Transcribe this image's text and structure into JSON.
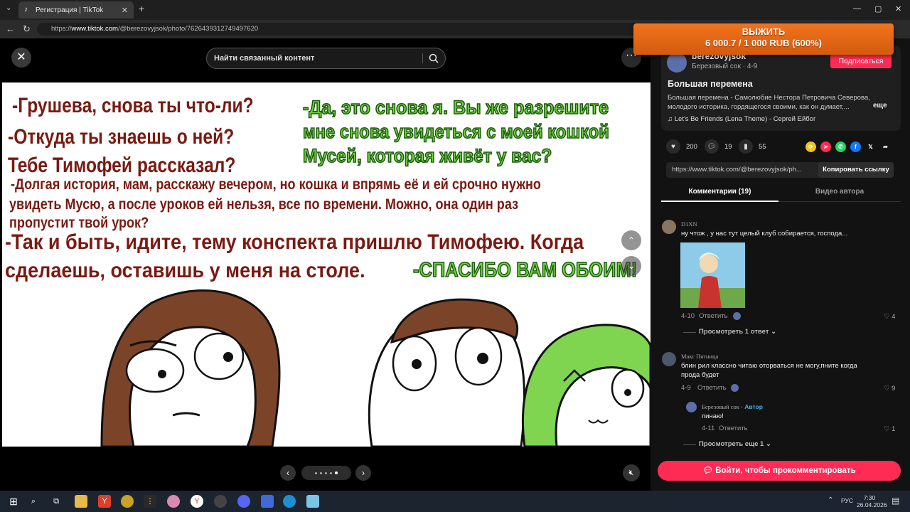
{
  "browser": {
    "tab_title": "Регистрация | TikTok",
    "url_prefix": "https://",
    "url_host": "www.tiktok.com",
    "url_path": "/@berezovyjsok/photo/7626439312749497620"
  },
  "viewer": {
    "search_placeholder": "Найти связанный контент",
    "comic_lines": [
      "-Грушева, снова ты что-ли?",
      "-Откуда ты знаешь о ней?",
      "Тебе Тимофей рассказал?",
      "-Долгая история, мам, расскажу вечером, но кошка и впрямь её и ей срочно нужно",
      "увидеть Мусю, а после уроков ей нельзя, все по времени. Можно, она один раз",
      "пропустит твой урок?",
      "-Так и быть, идите, тему конспекта пришлю Тимофею. Когда",
      "сделаешь, оставишь у меня на столе."
    ],
    "comic_green_lines": [
      "-Да, это снова я. Вы же разрешите",
      "мне снова увидеться с моей кошкой",
      "Мусей, которая живёт у вас?",
      "-СПАСИБО ВАМ ОБОИМ!"
    ],
    "slide_count": 5,
    "active_slide": 5
  },
  "overlay": {
    "title": "ВЫЖИТЬ",
    "amount": "6 000.7 / 1 000 RUB (600%)"
  },
  "author": {
    "name": "berezovyjsok",
    "subtitle": "Березовый сок · 4-9",
    "follow_label": "Подписаться"
  },
  "post": {
    "title": "Большая перемена",
    "description": "Большая перемена - Самолюбие Нестора Петровича Северова, молодого историка, гордящегося своими, как он думает,...",
    "more_label": "еще",
    "music": "Let's Be Friends (Lena Theme) - Сергей Ейбог"
  },
  "stats": {
    "likes": "200",
    "comments": "19",
    "saves": "55"
  },
  "link": {
    "text": "https://www.tiktok.com/@berezovyjsok/ph...",
    "copy_label": "Копировать ссылку"
  },
  "tabs": {
    "comments": "Комментарии (19)",
    "videos": "Видео автора"
  },
  "comments": [
    {
      "user": "D1XN",
      "text": "ну чтож , у нас тут целый клуб собирается, господа...",
      "date": "4-10",
      "reply_label": "Ответить",
      "likes": "4",
      "view_replies": "Просмотреть 1 ответ"
    },
    {
      "user": "Макс Пятница",
      "text_line1": "блин рил классно читаю оторваться не могу,пните когда",
      "text_line2": "прода будет",
      "date": "4-9",
      "reply_label": "Ответить",
      "likes": "9"
    }
  ],
  "reply": {
    "user": "Березовый сок",
    "author_tag": "· Автор",
    "text": "пинаю!",
    "date": "4-11",
    "reply_label": "Ответить",
    "likes": "1",
    "view_more": "Просмотреть еще 1"
  },
  "login_comment_label": "Войти, чтобы прокомментировать",
  "taskbar": {
    "lang": "РУС",
    "time": "7:30",
    "date": "26.04.2026"
  },
  "colors": {
    "tiktok_red": "#fe2c55",
    "comic_red_text": "#7a1a12",
    "comic_green_text": "#6fd43a",
    "overlay_orange": "#f2731c"
  }
}
